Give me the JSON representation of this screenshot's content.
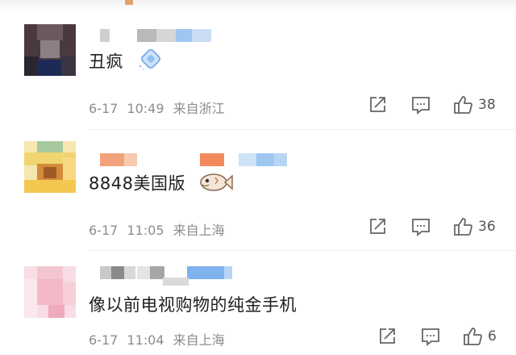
{
  "comments": [
    {
      "text": "丑疯",
      "date": "6-17",
      "time": "10:49",
      "location": "来自浙江",
      "likes": "38",
      "emoji_icon": "diamond-badge-icon"
    },
    {
      "text": "8848美国版",
      "date": "6-17",
      "time": "11:05",
      "location": "来自上海",
      "likes": "36",
      "emoji_icon": "fish-sticker-icon"
    },
    {
      "text": "像以前电视购物的纯金手机",
      "date": "6-17",
      "time": "11:04",
      "location": "来自上海",
      "likes": "6"
    }
  ],
  "colors": {
    "text": "#1f1f1f",
    "meta": "#8c8c8c",
    "icon": "#666666"
  }
}
